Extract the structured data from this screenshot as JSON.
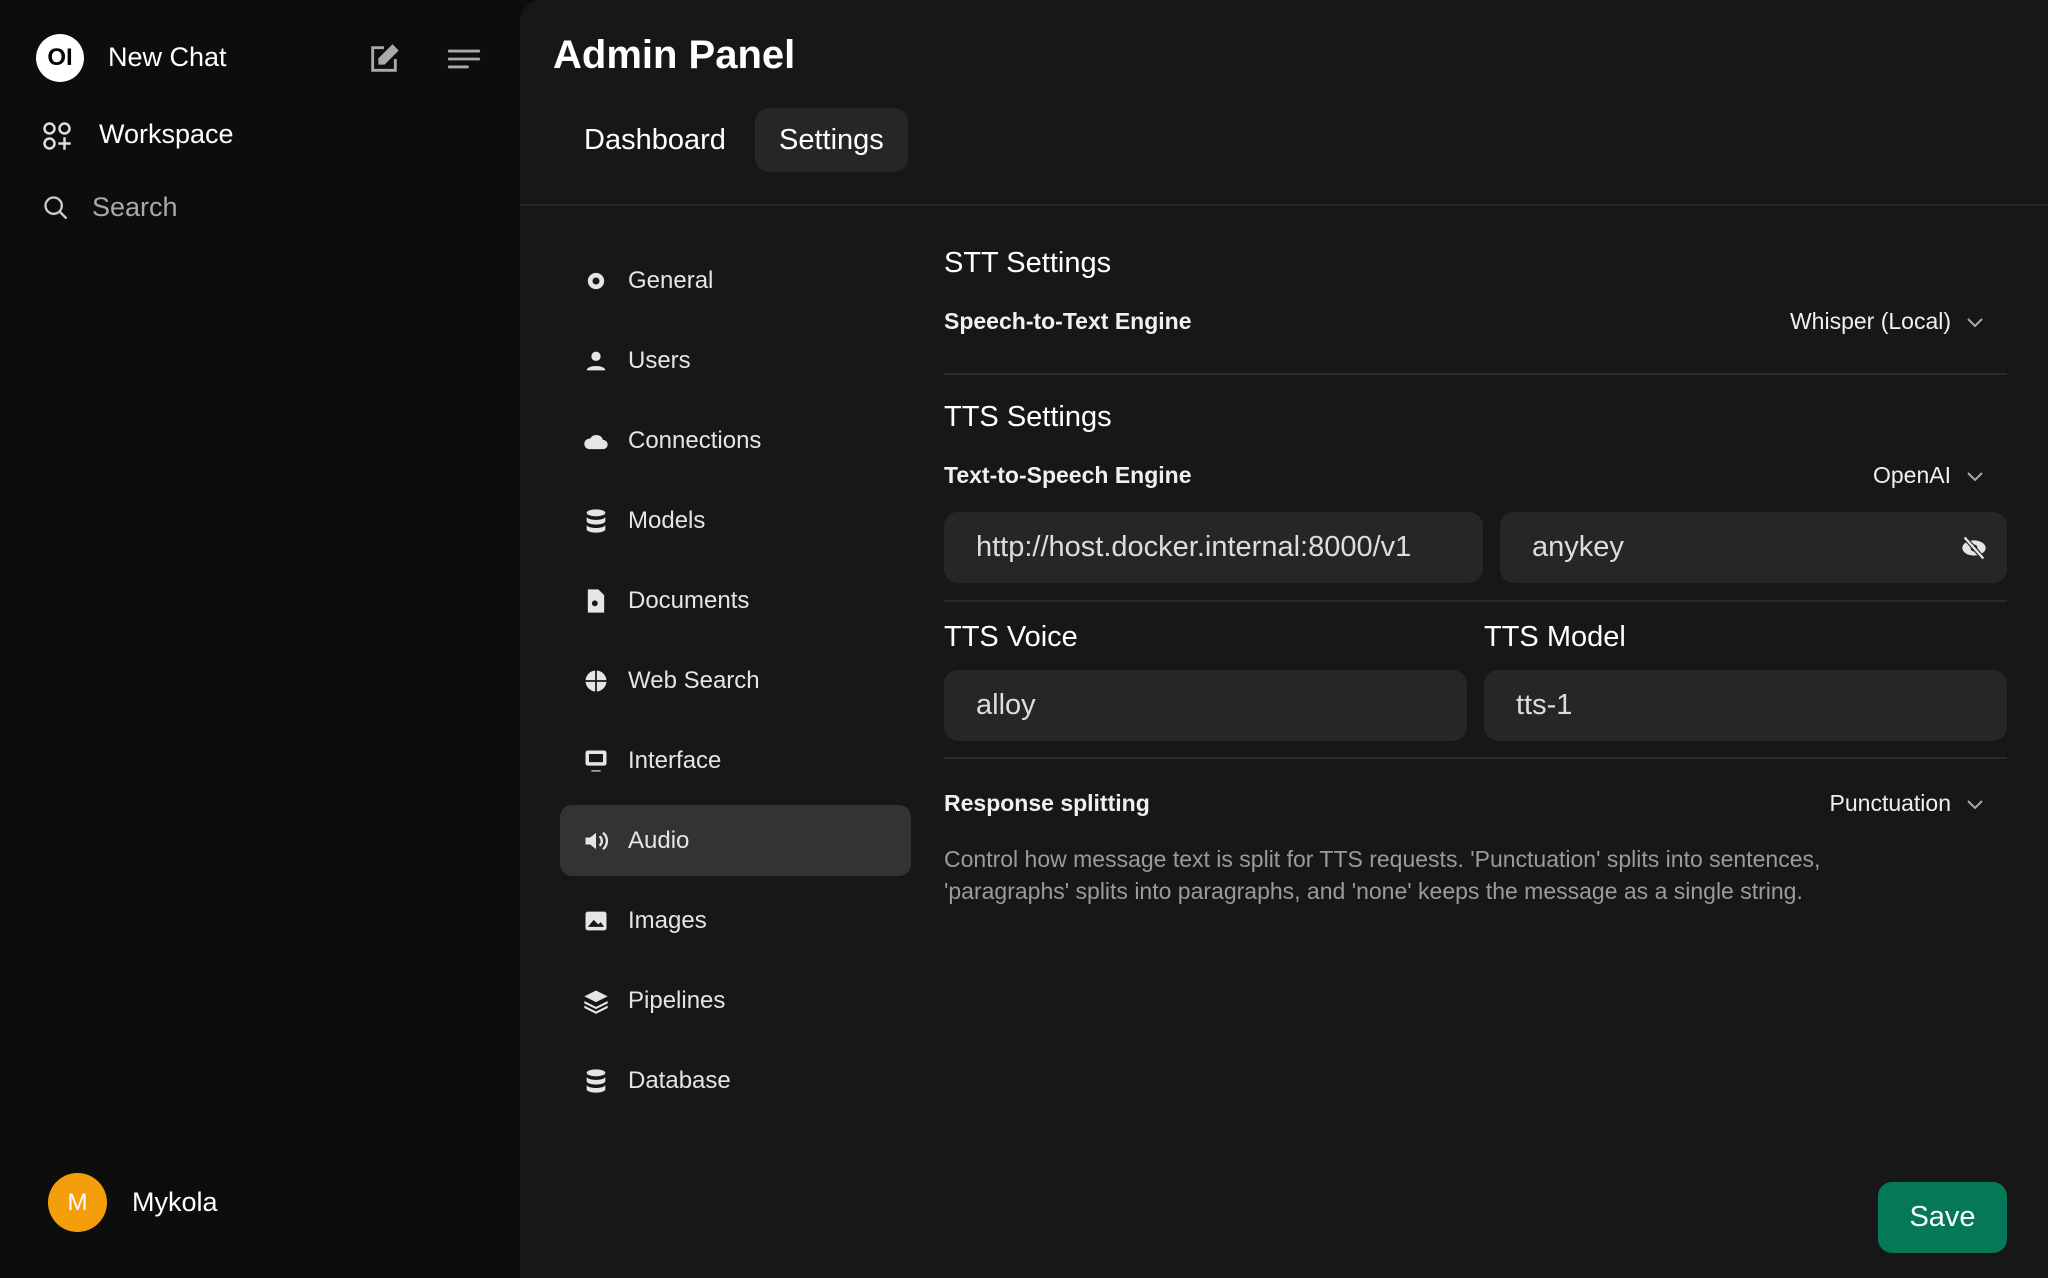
{
  "sidebar": {
    "logo_text": "OI",
    "new_chat": "New Chat",
    "workspace": "Workspace",
    "search": "Search",
    "user": {
      "initial": "M",
      "name": "Mykola",
      "avatar_color": "#f59e0b"
    }
  },
  "header": {
    "title": "Admin Panel",
    "tabs": [
      {
        "label": "Dashboard"
      },
      {
        "label": "Settings",
        "active": true
      }
    ]
  },
  "menu": [
    {
      "label": "General",
      "icon": "gear"
    },
    {
      "label": "Users",
      "icon": "users"
    },
    {
      "label": "Connections",
      "icon": "cloud"
    },
    {
      "label": "Models",
      "icon": "database"
    },
    {
      "label": "Documents",
      "icon": "document"
    },
    {
      "label": "Web Search",
      "icon": "globe"
    },
    {
      "label": "Interface",
      "icon": "monitor"
    },
    {
      "label": "Audio",
      "icon": "speaker",
      "active": true
    },
    {
      "label": "Images",
      "icon": "image"
    },
    {
      "label": "Pipelines",
      "icon": "layers"
    },
    {
      "label": "Database",
      "icon": "database"
    }
  ],
  "audio": {
    "stt_title": "STT Settings",
    "stt_engine_label": "Speech-to-Text Engine",
    "stt_engine_value": "Whisper (Local)",
    "tts_title": "TTS Settings",
    "tts_engine_label": "Text-to-Speech Engine",
    "tts_engine_value": "OpenAI",
    "api_base_url": "http://host.docker.internal:8000/v1",
    "api_key": "anykey",
    "voice_label": "TTS Voice",
    "voice_value": "alloy",
    "model_label": "TTS Model",
    "model_value": "tts-1",
    "split_label": "Response splitting",
    "split_value": "Punctuation",
    "split_desc_1": "Control how message text is split for TTS requests. 'Punctuation' splits into sentences,",
    "split_desc_2": "'paragraphs' splits into paragraphs, and 'none' keeps the message as a single string."
  },
  "save_label": "Save",
  "colors": {
    "save": "#047857",
    "active_item": "#333333"
  }
}
